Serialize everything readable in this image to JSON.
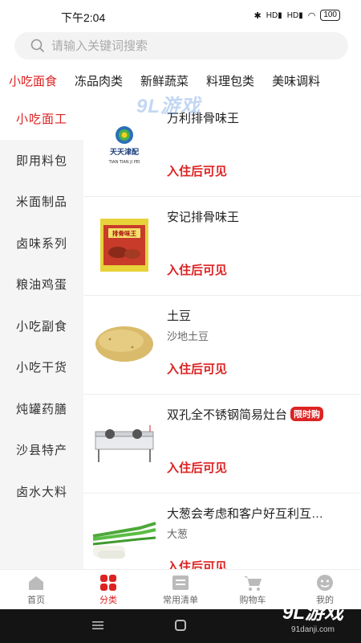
{
  "status": {
    "time": "下午2:04",
    "battery": "100",
    "signal1": "HD",
    "signal2": "HD"
  },
  "search": {
    "placeholder": "请输入关键词搜索"
  },
  "tabs": [
    "小吃面食",
    "冻品肉类",
    "新鲜蔬菜",
    "料理包类",
    "美味调料"
  ],
  "watermark": "9L游戏",
  "sidebar": [
    "小吃面工",
    "即用料包",
    "米面制品",
    "卤味系列",
    "粮油鸡蛋",
    "小吃副食",
    "小吃干货",
    "炖罐药膳",
    "沙县特产",
    "卤水大料"
  ],
  "products": [
    {
      "name": "万利排骨味王",
      "sub": "",
      "price": "入住后可见",
      "badge": "",
      "thumb_text": "天天津配",
      "thumb_sub": "TIAN TIAN JI PEI"
    },
    {
      "name": "安记排骨味王",
      "sub": "",
      "price": "入住后可见",
      "badge": "",
      "thumb_text": "排骨味王"
    },
    {
      "name": "土豆",
      "sub": "沙地土豆",
      "price": "入住后可见",
      "badge": ""
    },
    {
      "name": "双孔全不锈钢简易灶台",
      "sub": "",
      "price": "入住后可见",
      "badge": "限时购"
    },
    {
      "name": "大葱会考虑和客户好互利互…",
      "sub": "大葱",
      "price": "入住后可见",
      "badge": ""
    }
  ],
  "nav": [
    "首页",
    "分类",
    "常用清单",
    "购物车",
    "我的"
  ],
  "brand": {
    "name": "9L游戏",
    "url": "91danji.com"
  },
  "colors": {
    "accent": "#dd2222",
    "sidebar_bg": "#f5f5f5"
  }
}
